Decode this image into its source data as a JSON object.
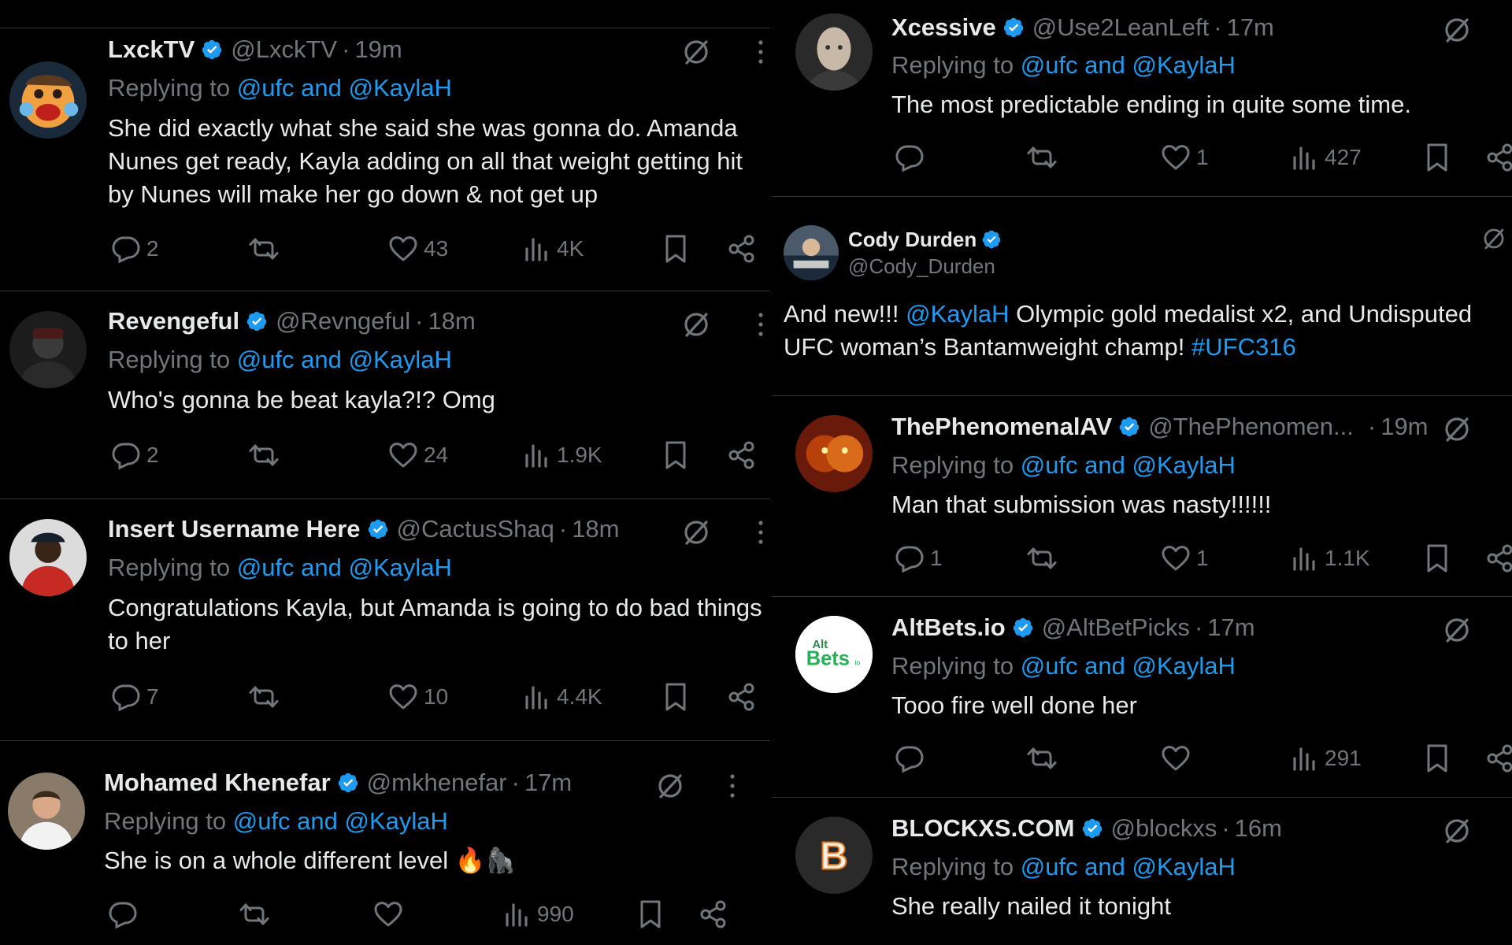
{
  "left": {
    "tweets": [
      {
        "name": "LxckTV",
        "handle": "@LxckTV",
        "time": "19m",
        "reply_prefix": "Replying to",
        "reply_mentions": "@ufc and @KaylaH",
        "text": "She did exactly what she said she was gonna do. Amanda Nunes get ready, Kayla adding on all that weight getting hit by Nunes will make her go down & not get up",
        "replies": "2",
        "reposts": "",
        "likes": "43",
        "views": "4K"
      },
      {
        "name": "Revengeful",
        "handle": "@Revngeful",
        "time": "18m",
        "reply_prefix": "Replying to",
        "reply_mentions": "@ufc and @KaylaH",
        "text": "Who's gonna be beat kayla?!? Omg",
        "replies": "2",
        "reposts": "",
        "likes": "24",
        "views": "1.9K"
      },
      {
        "name": "Insert Username Here",
        "handle": "@CactusShaq",
        "time": "18m",
        "reply_prefix": "Replying to",
        "reply_mentions": "@ufc and @KaylaH",
        "text": "Congratulations Kayla, but Amanda is going to do bad things to her",
        "replies": "7",
        "reposts": "",
        "likes": "10",
        "views": "4.4K"
      },
      {
        "name": "Mohamed Khenefar",
        "handle": "@mkhenefar",
        "time": "17m",
        "reply_prefix": "Replying to",
        "reply_mentions": "@ufc and @KaylaH",
        "text": "She is on a whole different level 🔥🦍",
        "replies": "",
        "reposts": "",
        "likes": "",
        "views": "990"
      }
    ]
  },
  "right": {
    "top": {
      "name": "Xcessive",
      "handle": "@Use2LeanLeft",
      "time": "17m",
      "reply_prefix": "Replying to",
      "reply_mentions": "@ufc and @KaylaH",
      "text": "The most predictable ending in quite some time.",
      "replies": "",
      "reposts": "",
      "likes": "1",
      "views": "427"
    },
    "cody": {
      "name": "Cody Durden",
      "handle": "@Cody_Durden",
      "text_a": "And new!!! ",
      "mention": "@KaylaH",
      "text_b": " Olympic gold medalist x2, and Undisputed UFC woman’s Bantamweight champ! ",
      "hashtag": "#UFC316"
    },
    "tweets": [
      {
        "name": "ThePhenomenalAV",
        "handle": "@ThePhenomen...",
        "time": "19m",
        "reply_prefix": "Replying to",
        "reply_mentions": "@ufc and @KaylaH",
        "text": "Man that submission was nasty!!!!!!",
        "replies": "1",
        "reposts": "",
        "likes": "1",
        "views": "1.1K"
      },
      {
        "name": "AltBets.io",
        "handle": "@AltBetPicks",
        "time": "17m",
        "reply_prefix": "Replying to",
        "reply_mentions": "@ufc and @KaylaH",
        "text": "Tooo fire well done her",
        "replies": "",
        "reposts": "",
        "likes": "",
        "views": "291"
      },
      {
        "name": "BLOCKXS.COM",
        "handle": "@blockxs",
        "time": "16m",
        "reply_prefix": "Replying to",
        "reply_mentions": "@ufc and @KaylaH",
        "text": "She really nailed it tonight",
        "replies": "",
        "reposts": "",
        "likes": "",
        "views": ""
      }
    ]
  },
  "avatars": {
    "altbets_line1": "Alt",
    "altbets_line2": "Bets",
    "altbets_sub": "io",
    "blockxs_letter": "B"
  },
  "colors": {
    "background": "#000000",
    "text": "#e7e9ea",
    "muted": "#71767b",
    "accent": "#1d9bf0",
    "divider": "#2f3336"
  },
  "icons": [
    "grok-icon",
    "more-icon",
    "reply-icon",
    "repost-icon",
    "like-icon",
    "views-icon",
    "bookmark-icon",
    "share-icon",
    "verified-badge-icon"
  ]
}
